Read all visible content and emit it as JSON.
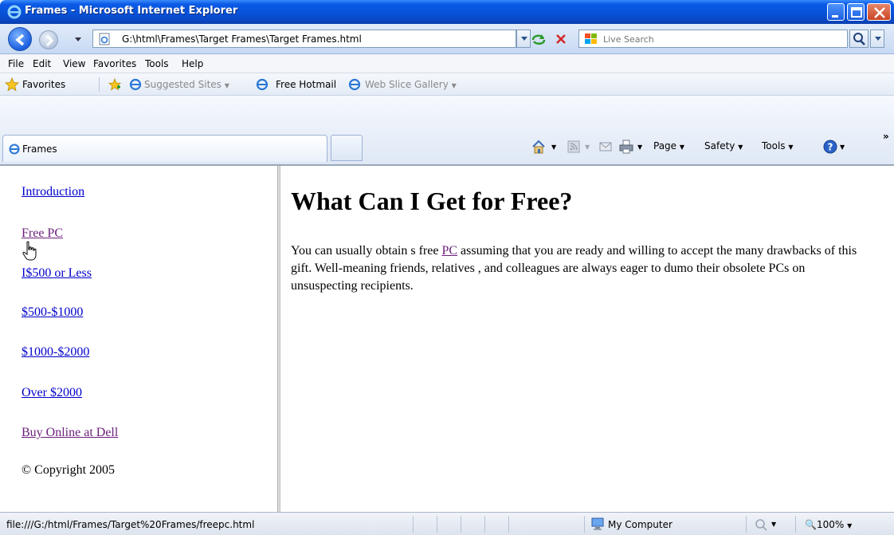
{
  "window": {
    "title": "Frames - Microsoft Internet Explorer"
  },
  "address_bar": {
    "url": "G:\\html\\Frames\\Target Frames\\Target Frames.html",
    "search_placeholder": "Live Search"
  },
  "menu": {
    "items": [
      "File",
      "Edit",
      "View",
      "Favorites",
      "Tools",
      "Help"
    ]
  },
  "favorites_bar": {
    "favorites_label": "Favorites",
    "suggested_sites": "Suggested Sites",
    "free_hotmail": "Free Hotmail",
    "web_slice_gallery": "Web Slice Gallery"
  },
  "tabs": {
    "active_tab_label": "Frames"
  },
  "command_bar": {
    "page": "Page",
    "safety": "Safety",
    "tools": "Tools"
  },
  "left_frame": {
    "links": [
      {
        "label": "Introduction",
        "visited": false
      },
      {
        "label": "Free PC",
        "visited": true
      },
      {
        "label": "I$500 or Less",
        "visited": false
      },
      {
        "label": "$500-$1000",
        "visited": false
      },
      {
        "label": "$1000-$2000",
        "visited": false
      },
      {
        "label": "Over $2000",
        "visited": false
      },
      {
        "label": "Buy Online at Dell",
        "visited": true
      }
    ],
    "copyright": "© Copyright 2005"
  },
  "right_frame": {
    "heading": "What Can I Get for Free?",
    "body_before_link": "You can usually obtain s free ",
    "body_link": "PC",
    "body_after_link": " assuming that you are ready and willing to accept the many drawbacks of this gift. Well-meaning friends, relatives , and colleagues are always eager to dumo their obsolete PCs on unsuspecting recipients."
  },
  "status_bar": {
    "url": "file:///G:/html/Frames/Target%20Frames/freepc.html",
    "zone": "My Computer",
    "zoom": "100%"
  },
  "colors": {
    "titlebar": "#0852d9",
    "link": "#0000cc",
    "visited_link": "#6b1f7a"
  }
}
